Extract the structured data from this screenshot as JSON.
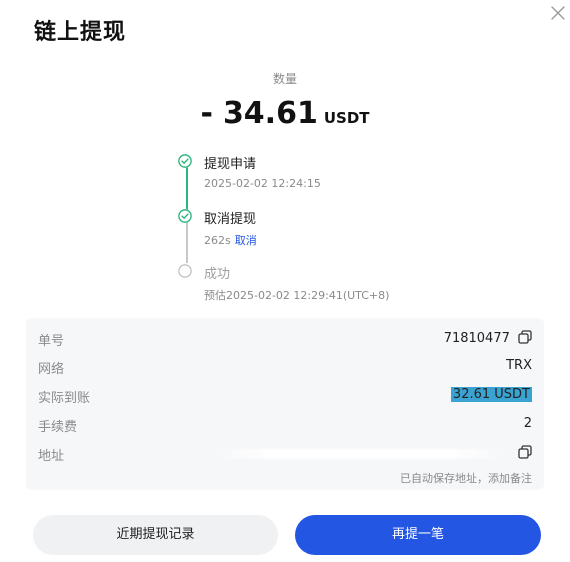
{
  "dialog": {
    "title": "链上提现"
  },
  "amount": {
    "label": "数量",
    "sign": "-",
    "value": "34.61",
    "unit": "USDT"
  },
  "steps": [
    {
      "label": "提现申请",
      "sub": "2025-02-02 12:24:15",
      "status": "done"
    },
    {
      "label": "取消提现",
      "sub": "262s",
      "link": "取消",
      "status": "done"
    },
    {
      "label": "成功",
      "sub": "预估2025-02-02 12:29:41(UTC+8)",
      "status": "pending"
    }
  ],
  "details": {
    "order_no": {
      "label": "单号",
      "value": "71810477"
    },
    "network": {
      "label": "网络",
      "value": "TRX"
    },
    "received": {
      "label": "实际到账",
      "value": "32.61 USDT"
    },
    "fee": {
      "label": "手续费",
      "value": "2"
    },
    "address": {
      "label": "地址",
      "value": ""
    },
    "note": "已自动保存地址，添加备注"
  },
  "buttons": {
    "history": "近期提现记录",
    "again": "再提一笔"
  },
  "colors": {
    "accent": "#2356e3",
    "success": "#2db57e",
    "highlight": "#3aa3d1"
  }
}
